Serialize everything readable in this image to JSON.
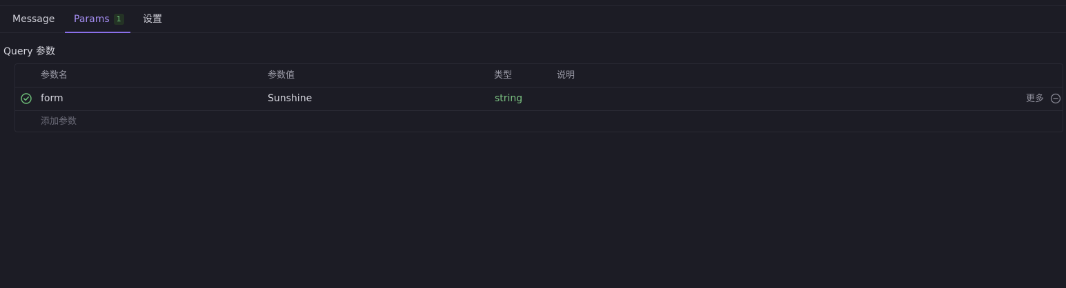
{
  "tabs": [
    {
      "label": "Message"
    },
    {
      "label": "Params",
      "badge": "1",
      "active": true
    },
    {
      "label": "设置"
    }
  ],
  "section": {
    "title": "Query 参数"
  },
  "table": {
    "headers": [
      "参数名",
      "参数值",
      "类型",
      "说明"
    ],
    "rows": [
      {
        "name": "form",
        "value": "Sunshine",
        "type": "string",
        "description": "",
        "more_label": "更多",
        "enabled": true
      }
    ],
    "add_placeholder": "添加参数"
  },
  "colors": {
    "accent": "#8a6fea",
    "type_green": "#7cc382",
    "background": "#1c1c25"
  },
  "icons": [
    "check-circle-icon",
    "minus-circle-icon"
  ]
}
